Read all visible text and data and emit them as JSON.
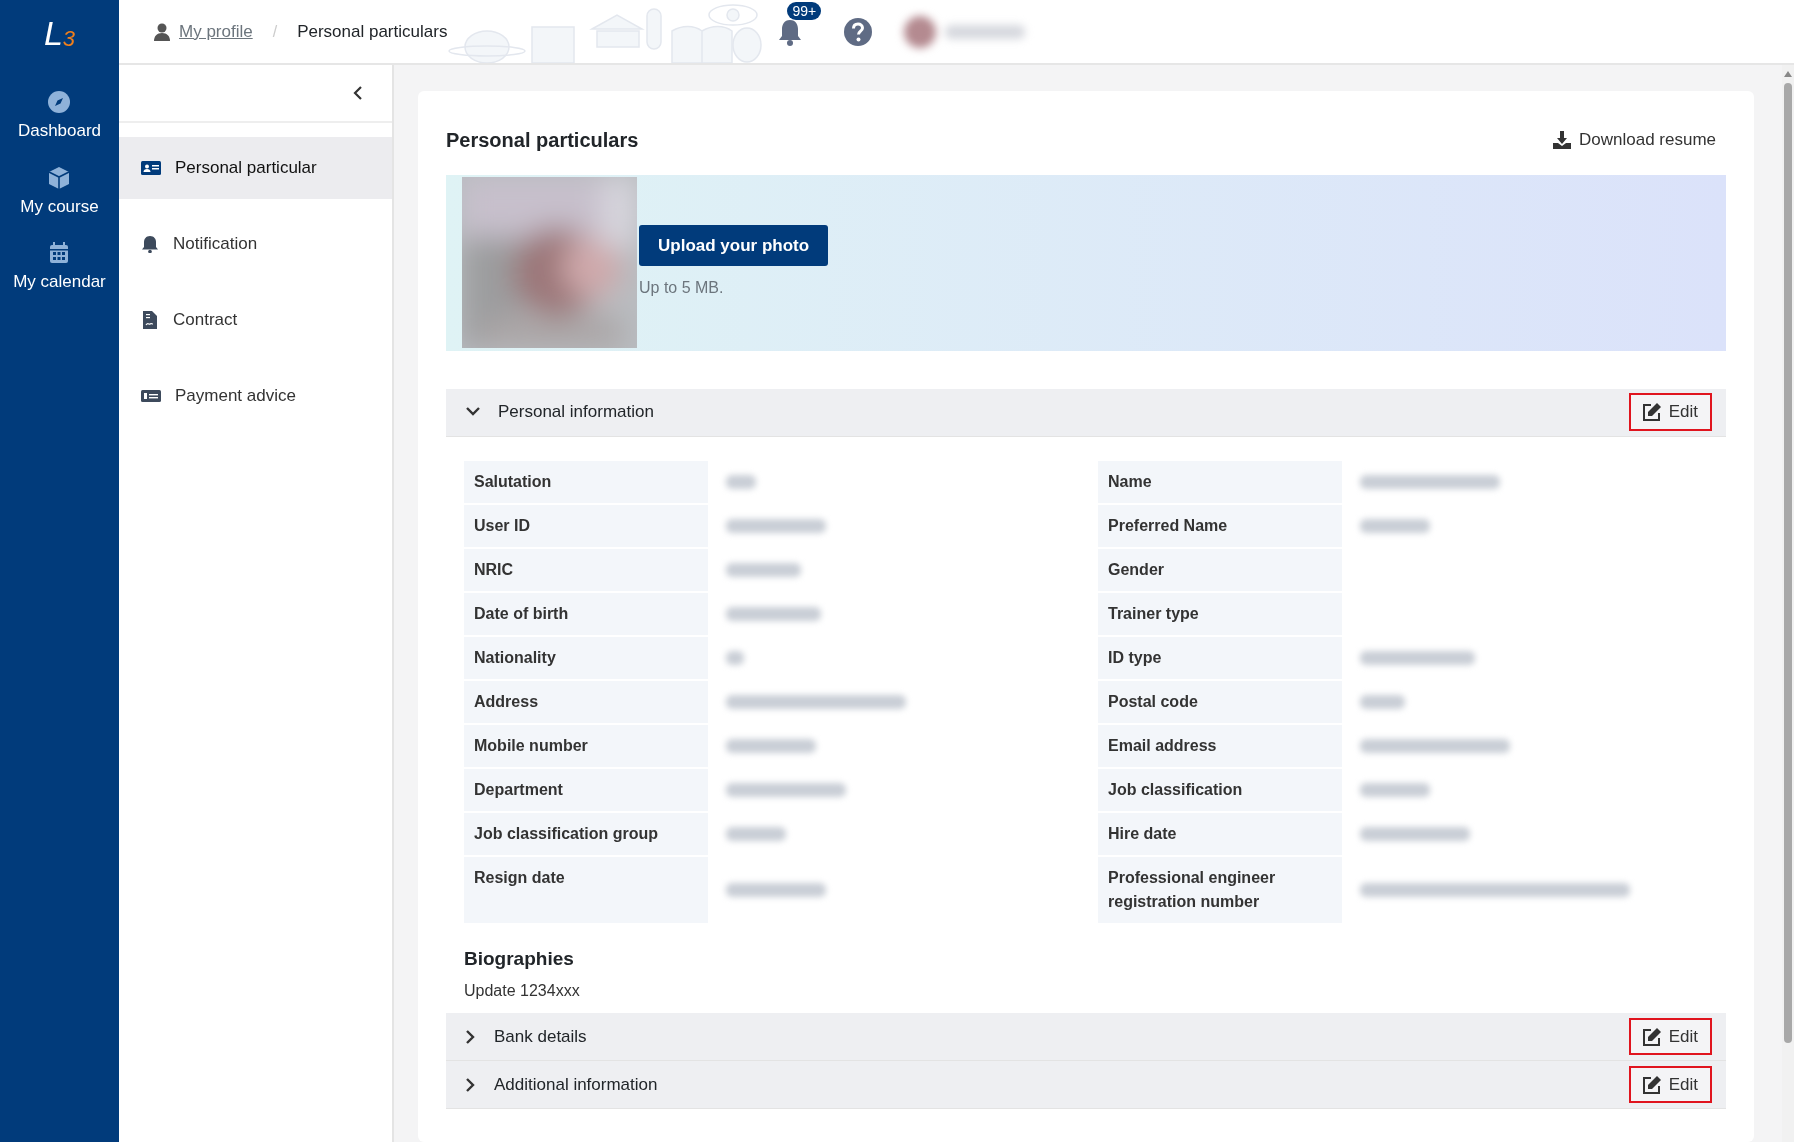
{
  "logo": {
    "letter": "L",
    "digit": "3"
  },
  "nav": [
    {
      "label": "Dashboard",
      "selected": false
    },
    {
      "label": "My course",
      "selected": false
    },
    {
      "label": "My calendar",
      "selected": false
    }
  ],
  "breadcrumb": [
    {
      "label": "My profile"
    },
    {
      "label": "Personal particulars"
    }
  ],
  "breadcrumb_separator": "/",
  "header": {
    "notification_count": "99+"
  },
  "submenu": {
    "items": [
      {
        "label": "Personal particular",
        "selected": true
      },
      {
        "label": "Notification",
        "selected": false
      },
      {
        "label": "Contract",
        "selected": false
      },
      {
        "label": "Payment advice",
        "selected": false
      }
    ]
  },
  "card": {
    "title": "Personal particulars",
    "download": "Download resume",
    "upload_button": "Upload your photo",
    "upload_hint": "Up to 5 MB."
  },
  "sections": [
    {
      "title": "Personal information",
      "expanded": true,
      "edit": "Edit",
      "highlighted": true,
      "fields": [
        {
          "label": "Salutation",
          "kind": "blurred"
        },
        {
          "label": "Name",
          "kind": "blurred"
        },
        {
          "label": "User ID",
          "kind": "blurred"
        },
        {
          "label": "Preferred Name",
          "kind": "blurred"
        },
        {
          "label": "NRIC",
          "kind": "blurred"
        },
        {
          "label": "Gender",
          "kind": "empty"
        },
        {
          "label": "Date of birth",
          "kind": "blurred"
        },
        {
          "label": "Trainer type",
          "kind": "empty"
        },
        {
          "label": "Nationality",
          "kind": "blurred"
        },
        {
          "label": "ID type",
          "kind": "blurred"
        },
        {
          "label": "Address",
          "kind": "blurred"
        },
        {
          "label": "Postal code",
          "kind": "blurred"
        },
        {
          "label": "Mobile number",
          "kind": "blurred"
        },
        {
          "label": "Email address",
          "kind": "blurred"
        },
        {
          "label": "Department",
          "kind": "blurred"
        },
        {
          "label": "Job classification",
          "kind": "blurred"
        },
        {
          "label": "Job classification group",
          "kind": "blurred"
        },
        {
          "label": "Hire date",
          "kind": "blurred"
        },
        {
          "label": "Resign date",
          "kind": "blurred"
        },
        {
          "label": "Professional engineer registration number",
          "kind": "blurred"
        }
      ],
      "biographies": {
        "title": "Biographies",
        "text": "Update 1234xxx"
      }
    },
    {
      "title": "Bank details",
      "expanded": false,
      "edit": "Edit",
      "highlighted": true
    },
    {
      "title": "Additional information",
      "expanded": false,
      "edit": "Edit",
      "highlighted": true
    }
  ]
}
